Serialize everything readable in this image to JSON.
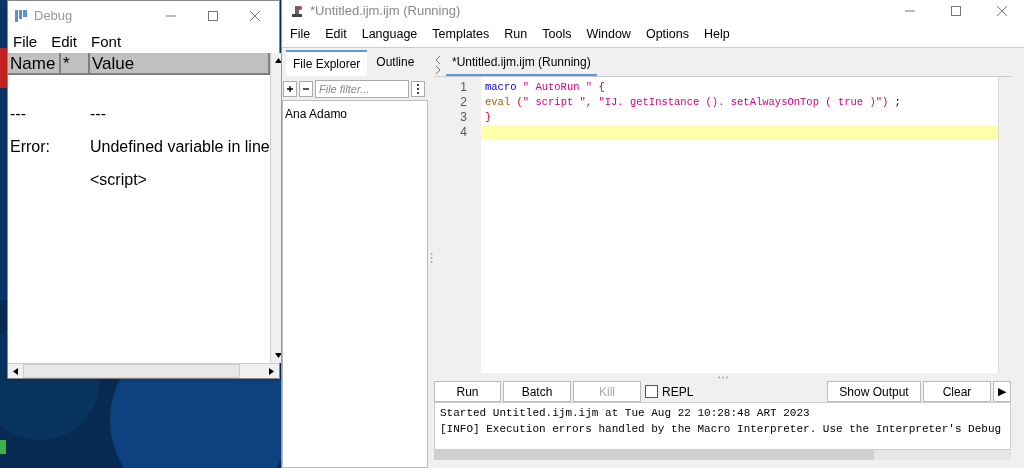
{
  "debug_window": {
    "title": "Debug",
    "menu": [
      "File",
      "Edit",
      "Font"
    ],
    "columns": [
      "Name",
      "*",
      "Value"
    ],
    "rows": [
      {
        "name": "---",
        "value": "---"
      },
      {
        "name": "Error:",
        "value": "Undefined variable in line"
      },
      {
        "value": "<script>"
      }
    ]
  },
  "editor_window": {
    "title": "*Untitled.ijm.ijm (Running)",
    "menu": [
      "File",
      "Edit",
      "Language",
      "Templates",
      "Run",
      "Tools",
      "Window",
      "Options",
      "Help"
    ],
    "side_tabs": [
      {
        "label": "File Explorer",
        "selected": true
      },
      {
        "label": "Outline",
        "selected": false
      }
    ],
    "file_filter": {
      "placeholder": "File filter..."
    },
    "files": [
      "Ana Adamo"
    ],
    "editor_tabs": [
      {
        "label": "*Untitled.ijm.ijm (Running)",
        "selected": true
      }
    ],
    "code_lines": [
      {
        "number": "1",
        "highlighted": false,
        "tokens": [
          {
            "kind": "keyword",
            "text": "macro"
          },
          {
            "kind": "string",
            "text": " \" AutoRun \" "
          },
          {
            "kind": "paren",
            "text": "{"
          }
        ]
      },
      {
        "number": "2",
        "highlighted": false,
        "tokens": [
          {
            "kind": "function",
            "text": "eval"
          },
          {
            "kind": "paren",
            "text": " ("
          },
          {
            "kind": "string",
            "text": "\" script \", \"IJ. getInstance (). setAlwaysOnTop ( true )\""
          },
          {
            "kind": "paren",
            "text": ")"
          },
          {
            "kind": "plain",
            "text": " ;"
          }
        ]
      },
      {
        "number": "3",
        "highlighted": false,
        "tokens": [
          {
            "kind": "paren",
            "text": "}"
          }
        ]
      },
      {
        "number": "4",
        "highlighted": true
      }
    ],
    "buttons": [
      {
        "label": "Run",
        "disabled": false
      },
      {
        "label": "Batch",
        "disabled": false
      },
      {
        "label": "Kill",
        "disabled": true
      }
    ],
    "repl": {
      "label": "REPL",
      "checked": false
    },
    "right_buttons": [
      "Show Output",
      "Clear"
    ],
    "expand_button": "▶",
    "output": [
      "Started Untitled.ijm.ijm at Tue Aug 22 10:28:48 ART 2023",
      "[INFO] Execution errors handled by the Macro Interpreter. Use the Interpreter's Debug"
    ]
  }
}
